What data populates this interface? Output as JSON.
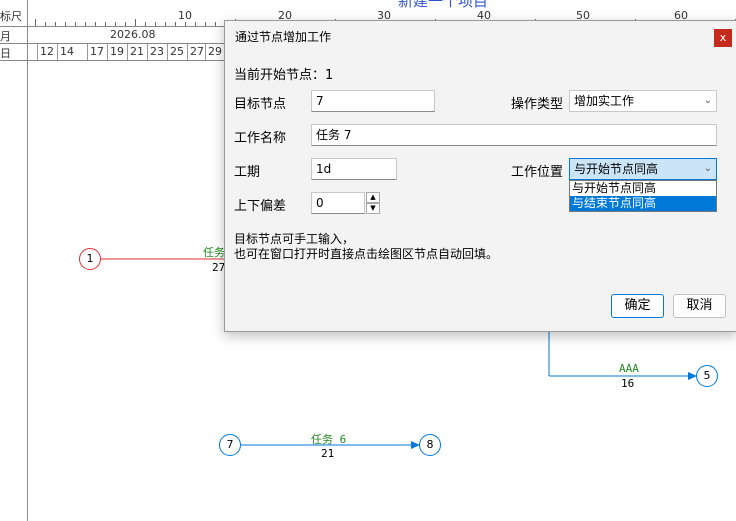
{
  "background": {
    "ruler": {
      "row1_label": "标尺",
      "row2_label": "月",
      "row3_label": "日",
      "top_title": "新建一个项目",
      "scale_numbers": [
        "10",
        "20",
        "30",
        "40",
        "50",
        "60"
      ],
      "month": "2026.08",
      "days": [
        "12",
        "14",
        "17",
        "19",
        "21",
        "23",
        "25",
        "27",
        "29"
      ]
    },
    "network": {
      "task_fragment_label": "任务",
      "task_fragment_num": "27",
      "node1": "1",
      "node5": "5",
      "aaa_label": "AAA",
      "aaa_num": "16",
      "node7": "7",
      "node8": "8",
      "task6_label": "任务 6",
      "task6_num": "21"
    }
  },
  "dialog": {
    "title": "通过节点增加工作",
    "close_label": "x",
    "current_start_label": "当前开始节点：1",
    "target_node_label": "目标节点",
    "target_node_value": "7",
    "op_type_label": "操作类型",
    "op_type_value": "增加实工作",
    "work_name_label": "工作名称",
    "work_name_value": "任务 7",
    "duration_label": "工期",
    "duration_value": "1d",
    "work_position_label": "工作位置",
    "work_position_value": "与开始节点同高",
    "position_options": [
      "与开始节点同高",
      "与结束节点同高"
    ],
    "offset_label": "上下偏差",
    "offset_value": "0",
    "hint_line1": "目标节点可手工输入，",
    "hint_line2": "也可在窗口打开时直接点击绘图区节点自动回填。",
    "ok_label": "确定",
    "cancel_label": "取消"
  },
  "colors": {
    "accent_blue": "#0078d7",
    "task_green": "#228b22",
    "node1_red": "#e03030",
    "arrow_green": "#22dd22",
    "close_red": "#c42b1c"
  }
}
